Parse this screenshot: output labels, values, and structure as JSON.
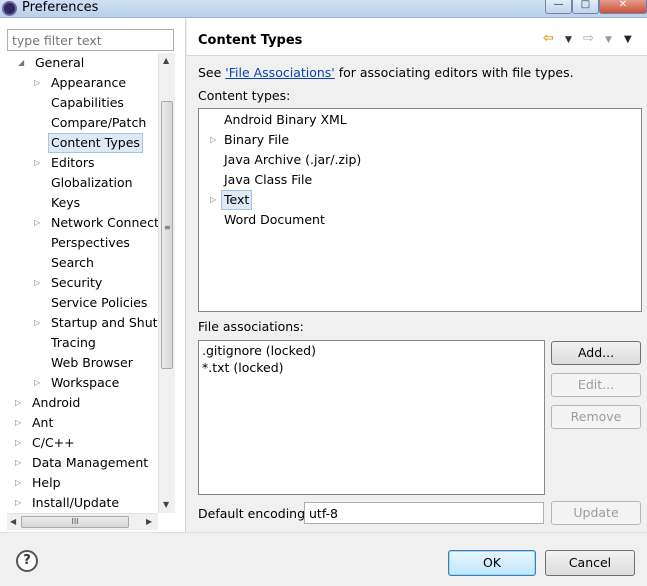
{
  "window": {
    "title": "Preferences",
    "min_glyph": "—",
    "max_glyph": "□",
    "close_glyph": "✕"
  },
  "filter": {
    "placeholder": "type filter text"
  },
  "tree": {
    "items": [
      {
        "label": "General",
        "expanded": true
      },
      {
        "label": "Appearance"
      },
      {
        "label": "Capabilities"
      },
      {
        "label": "Compare/Patch"
      },
      {
        "label": "Content Types",
        "selected": true
      },
      {
        "label": "Editors"
      },
      {
        "label": "Globalization"
      },
      {
        "label": "Keys"
      },
      {
        "label": "Network Connectio"
      },
      {
        "label": "Perspectives"
      },
      {
        "label": "Search"
      },
      {
        "label": "Security"
      },
      {
        "label": "Service Policies"
      },
      {
        "label": "Startup and Shutd"
      },
      {
        "label": "Tracing"
      },
      {
        "label": "Web Browser"
      },
      {
        "label": "Workspace"
      },
      {
        "label": "Android"
      },
      {
        "label": "Ant"
      },
      {
        "label": "C/C++"
      },
      {
        "label": "Data Management"
      },
      {
        "label": "Help"
      },
      {
        "label": "Install/Update"
      }
    ],
    "hscroll_grip": "III",
    "vscroll_grip": "≡"
  },
  "page": {
    "title": "Content Types",
    "see_prefix": "See ",
    "see_link": "'File Associations'",
    "see_suffix": " for associating editors with file types.",
    "content_types_label": "Content types:",
    "content_types": [
      {
        "label": "Android Binary XML"
      },
      {
        "label": "Binary File",
        "expandable": true
      },
      {
        "label": "Java Archive (.jar/.zip)"
      },
      {
        "label": "Java Class File"
      },
      {
        "label": "Text",
        "expandable": true,
        "selected": true
      },
      {
        "label": "Word Document"
      }
    ],
    "file_assoc_label": "File associations:",
    "file_associations": [
      ".gitignore (locked)",
      "*.txt (locked)"
    ],
    "buttons": {
      "add": "Add...",
      "edit": "Edit...",
      "remove": "Remove",
      "update": "Update"
    },
    "encoding_label": "Default encoding:",
    "encoding_value": "utf-8"
  },
  "footer": {
    "ok": "OK",
    "cancel": "Cancel",
    "help_glyph": "?"
  }
}
